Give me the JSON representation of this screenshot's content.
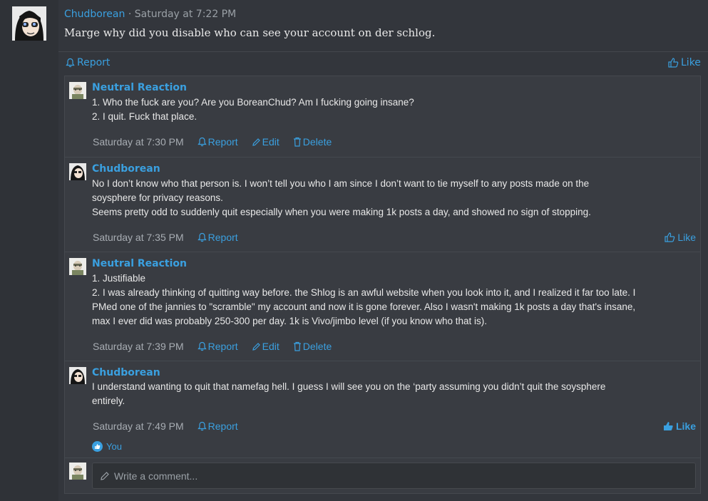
{
  "post": {
    "author": "Chudborean",
    "separator": "·",
    "time": "Saturday at 7:22 PM",
    "text": "Marge why did you disable who can see your account on der schlog.",
    "report_label": "Report",
    "like_label": "Like"
  },
  "comments": [
    {
      "author": "Neutral Reaction",
      "lines": [
        "1. Who the fuck are you? Are you BoreanChud? Am I fucking going insane?",
        "2. I quit. Fuck that place."
      ],
      "time": "Saturday at 7:30 PM",
      "report_label": "Report",
      "edit_label": "Edit",
      "delete_label": "Delete"
    },
    {
      "author": "Chudborean",
      "lines": [
        "No I don’t know who that person is. I won’t tell you who I am since I don’t want to tie myself to any posts made on the",
        "soysphere for privacy reasons.",
        "Seems pretty odd to suddenly quit especially when you were making 1k posts a day, and showed no sign of stopping."
      ],
      "time": "Saturday at 7:35 PM",
      "report_label": "Report",
      "like_label": "Like"
    },
    {
      "author": "Neutral Reaction",
      "lines": [
        "1. Justifiable",
        "2. I was already thinking of quitting way before. the Shlog is an awful website when you look into it, and I realized it far too late. I",
        "PMed one of the jannies to \"scramble\" my account and now it is gone forever. Also I wasn't making 1k posts a day that's insane,",
        "max I ever did was probably 250-300 per day. 1k is Vivo/jimbo level (if you know who that is)."
      ],
      "time": "Saturday at 7:39 PM",
      "report_label": "Report",
      "edit_label": "Edit",
      "delete_label": "Delete"
    },
    {
      "author": "Chudborean",
      "lines": [
        "I understand wanting to quit that namefag hell. I guess I will see you on the ‘party assuming you didn’t quit the soysphere",
        "entirely."
      ],
      "time": "Saturday at 7:49 PM",
      "report_label": "Report",
      "like_label": "Like",
      "reactions_label": "You"
    }
  ],
  "reply": {
    "placeholder": "Write a comment..."
  },
  "colors": {
    "accent": "#3aa0e0",
    "background": "#33363c",
    "comment_bg": "#393c42"
  }
}
